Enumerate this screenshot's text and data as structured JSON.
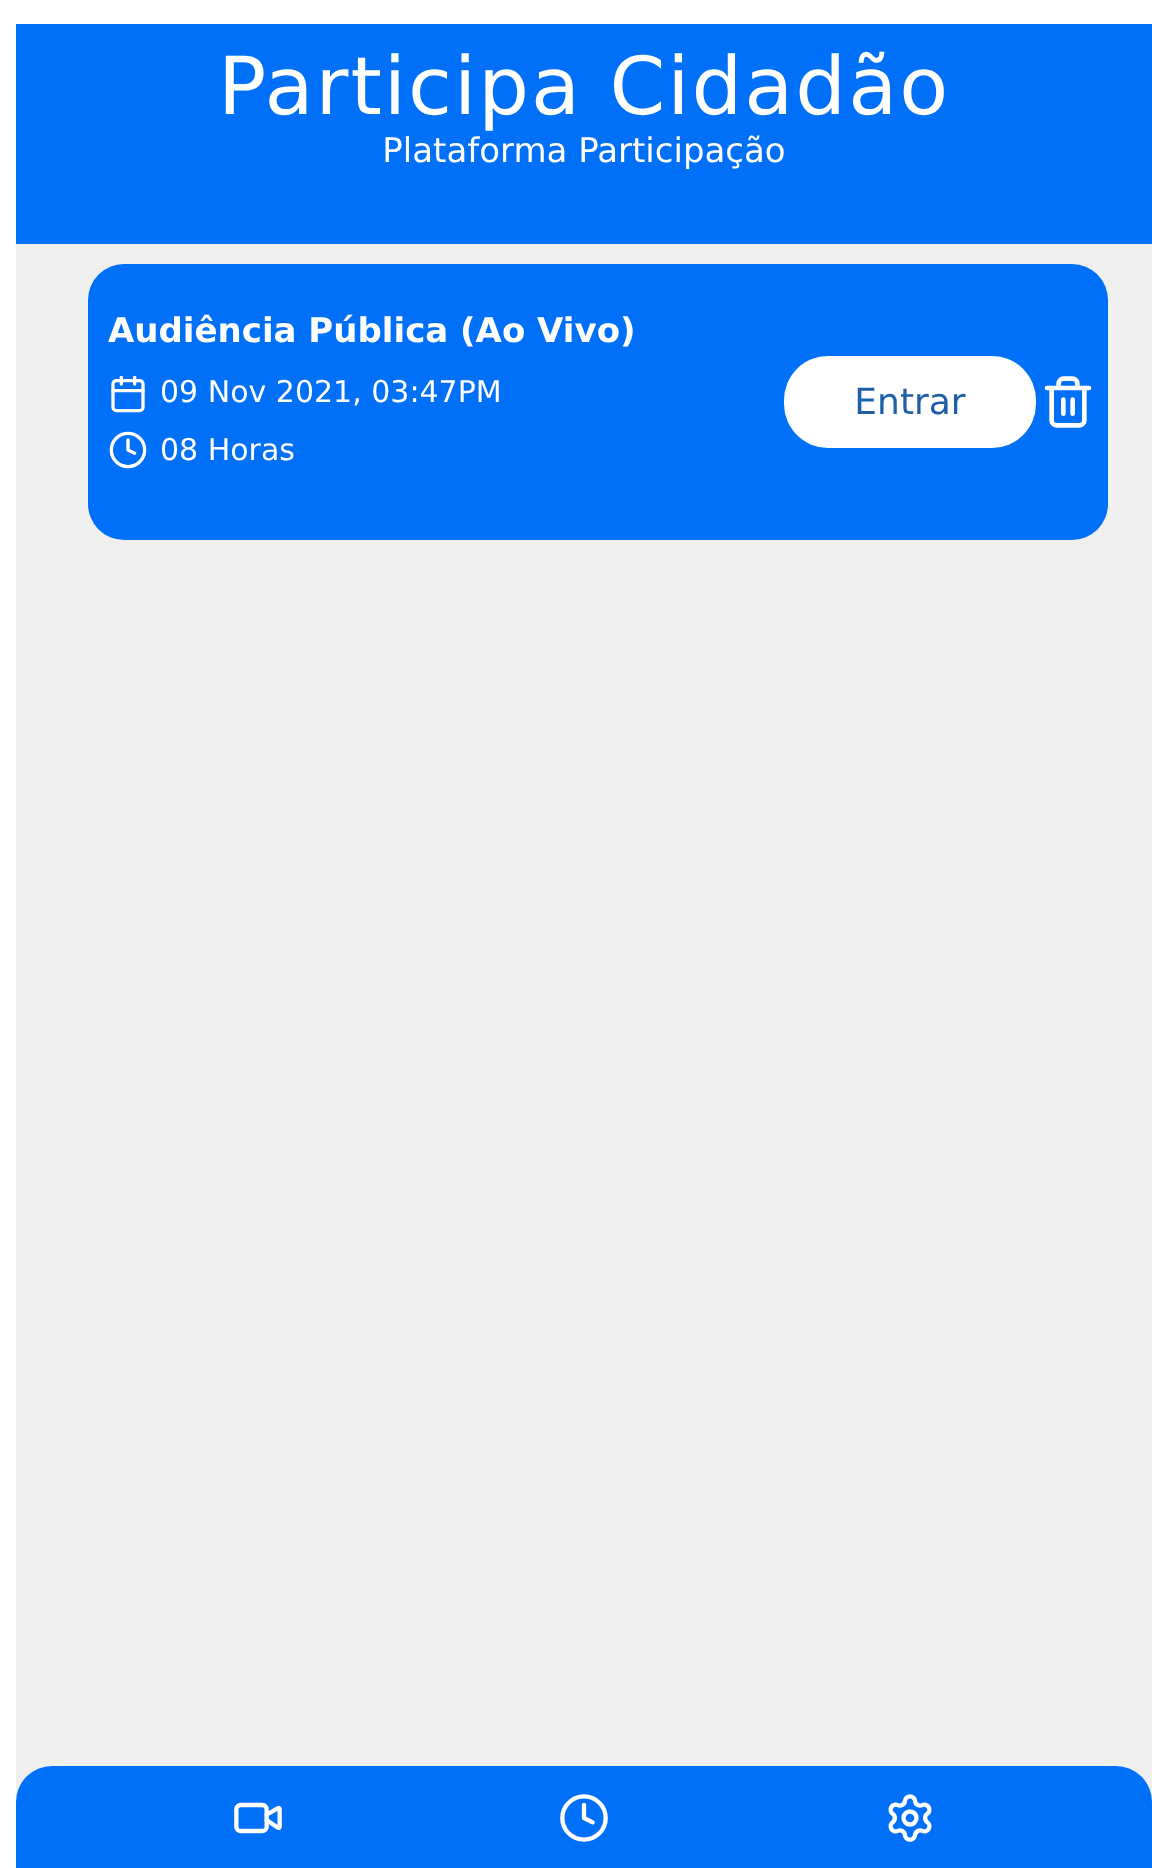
{
  "header": {
    "title": "Participa Cidadão",
    "subtitle": "Plataforma Participação"
  },
  "sessions": [
    {
      "title": "Audiência Pública (Ao Vivo)",
      "date": "09 Nov 2021, 03:47PM",
      "duration": "08 Horas",
      "action": "Entrar"
    }
  ]
}
